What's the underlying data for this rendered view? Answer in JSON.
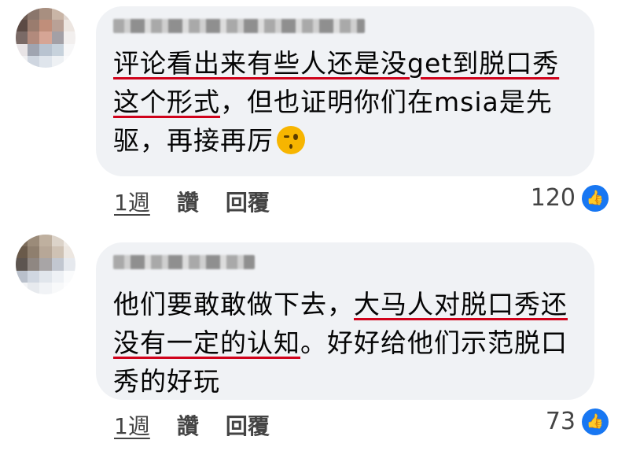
{
  "comments": [
    {
      "text_parts": [
        {
          "t": "评论看出来有些人还是没get到脱口秀这个形式",
          "ul": true
        },
        {
          "t": "，但也证明你们在msia是先驱，再接再厉",
          "ul": false
        }
      ],
      "emoji_icon": "winking-face-icon",
      "time": "1週",
      "like_label": "讚",
      "reply_label": "回覆",
      "reaction_count": "120",
      "reaction_icon": "like-icon"
    },
    {
      "text_parts": [
        {
          "t": "他们要敢敢做下去，",
          "ul": false
        },
        {
          "t": "大马人对脱口秀还没有一定的认知",
          "ul": true
        },
        {
          "t": "。好好给他们示范脱口秀的好玩",
          "ul": false
        }
      ],
      "emoji_icon": "",
      "time": "1週",
      "like_label": "讚",
      "reply_label": "回覆",
      "reaction_count": "73",
      "reaction_icon": "like-icon"
    }
  ],
  "colors": {
    "accent_underline": "#d0021b",
    "like_blue": "#1877f2",
    "bubble": "#f0f2f5"
  }
}
